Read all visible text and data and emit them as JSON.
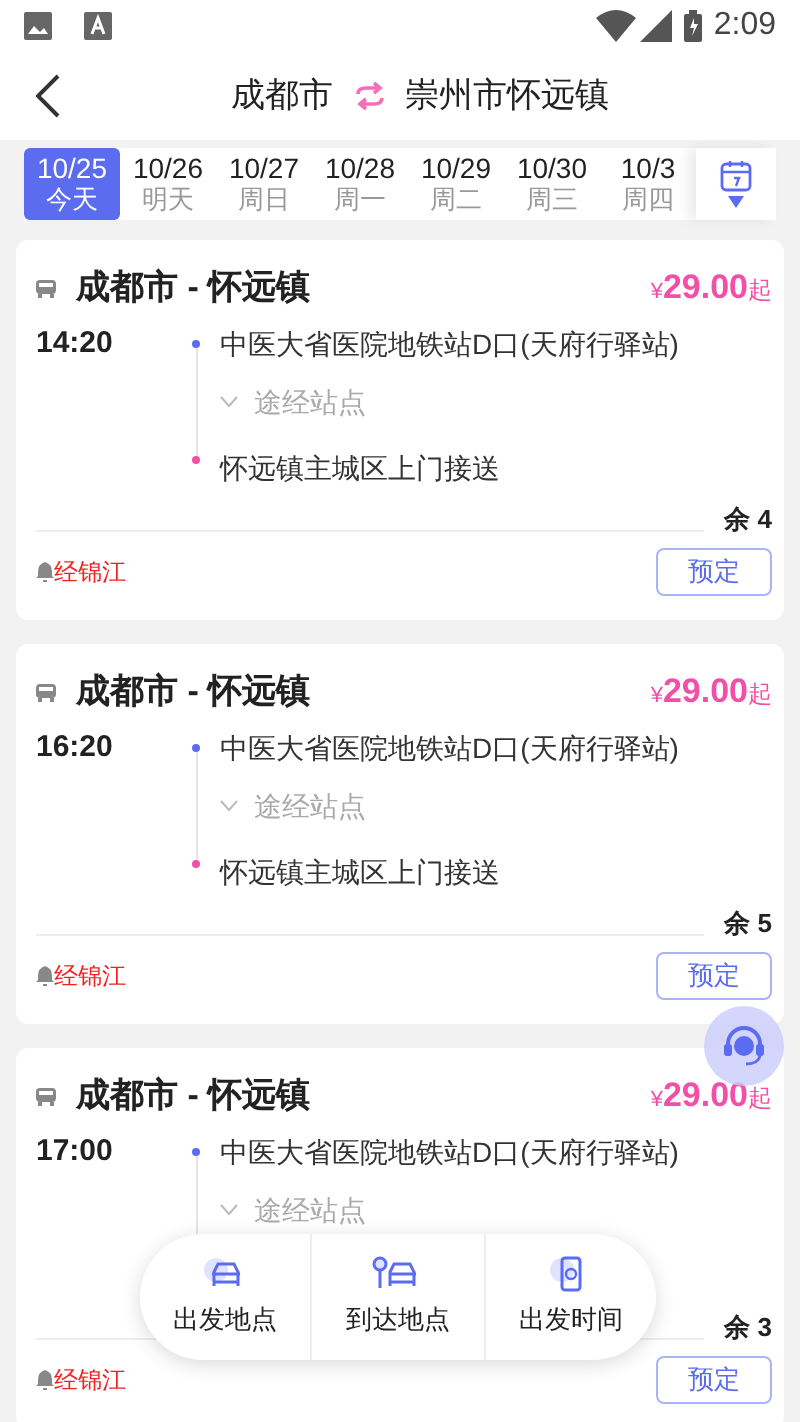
{
  "status_bar": {
    "time": "2:09"
  },
  "header": {
    "from": "成都市",
    "to": "崇州市怀远镇"
  },
  "dates": [
    {
      "date": "10/25",
      "weekday": "今天",
      "selected": true
    },
    {
      "date": "10/26",
      "weekday": "明天",
      "selected": false
    },
    {
      "date": "10/27",
      "weekday": "周日",
      "selected": false
    },
    {
      "date": "10/28",
      "weekday": "周一",
      "selected": false
    },
    {
      "date": "10/29",
      "weekday": "周二",
      "selected": false
    },
    {
      "date": "10/30",
      "weekday": "周三",
      "selected": false
    },
    {
      "date": "10/3",
      "weekday": "周四",
      "selected": false
    }
  ],
  "trips": [
    {
      "route": "成都市 - 怀远镇",
      "currency": "¥",
      "price": "29.00",
      "price_suffix": "起",
      "time": "14:20",
      "origin": "中医大省医院地铁站D口(天府行驿站)",
      "via": "途经站点",
      "destination": "怀远镇主城区上门接送",
      "seats": "余 4",
      "note": "经锦江",
      "button": "预定"
    },
    {
      "route": "成都市 - 怀远镇",
      "currency": "¥",
      "price": "29.00",
      "price_suffix": "起",
      "time": "16:20",
      "origin": "中医大省医院地铁站D口(天府行驿站)",
      "via": "途经站点",
      "destination": "怀远镇主城区上门接送",
      "seats": "余 5",
      "note": "经锦江",
      "button": "预定"
    },
    {
      "route": "成都市 - 怀远镇",
      "currency": "¥",
      "price": "29.00",
      "price_suffix": "起",
      "time": "17:00",
      "origin": "中医大省医院地铁站D口(天府行驿站)",
      "via": "途经站点",
      "seats": "余 3",
      "note": "经锦江",
      "button": "预定"
    }
  ],
  "filter_bar": [
    {
      "label": "出发地点",
      "kind": "departure"
    },
    {
      "label": "到达地点",
      "kind": "arrival"
    },
    {
      "label": "出发时间",
      "kind": "time"
    }
  ]
}
